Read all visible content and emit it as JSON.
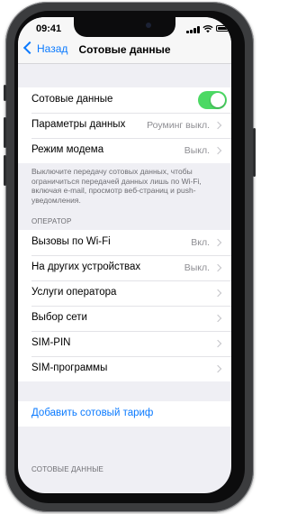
{
  "status_bar": {
    "time": "09:41"
  },
  "nav": {
    "back_label": "Назад",
    "title": "Сотовые данные"
  },
  "group1": {
    "cellular_data_label": "Сотовые данные",
    "cellular_data_enabled": true,
    "data_options_label": "Параметры данных",
    "data_options_value": "Роуминг выкл.",
    "hotspot_label": "Режим модема",
    "hotspot_value": "Выкл."
  },
  "group1_footer": "Выключите передачу сотовых данных, чтобы ограничиться передачей данных лишь по Wi-Fi, включая e-mail, просмотр веб-страниц и push-уведомления.",
  "operator_section": {
    "header": "ОПЕРАТОР",
    "items": [
      {
        "label": "Вызовы по Wi-Fi",
        "value": "Вкл."
      },
      {
        "label": "На других устройствах",
        "value": "Выкл."
      },
      {
        "label": "Услуги оператора",
        "value": ""
      },
      {
        "label": "Выбор сети",
        "value": ""
      },
      {
        "label": "SIM-PIN",
        "value": ""
      },
      {
        "label": "SIM-программы",
        "value": ""
      }
    ]
  },
  "add_plan_label": "Добавить сотовый тариф",
  "bottom_section_header": "СОТОВЫЕ ДАННЫЕ",
  "colors": {
    "accent": "#0a7aff",
    "toggle_on": "#4cd964",
    "background": "#efeff4"
  }
}
